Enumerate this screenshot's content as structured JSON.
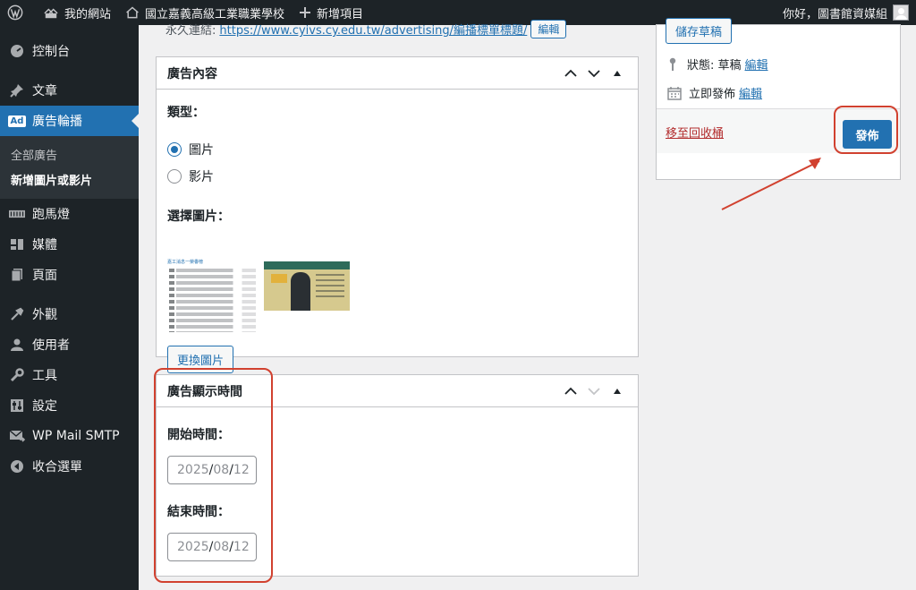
{
  "adminbar": {
    "site_name": "我的網站",
    "school_name": "國立嘉義高級工業職業學校",
    "new_item": "新增項目",
    "greeting": "你好，圖書館資媒組"
  },
  "sidebar": {
    "items": [
      {
        "label": "控制台",
        "icon": "dashboard-icon"
      },
      {
        "label": "文章",
        "icon": "pin-icon"
      },
      {
        "label": "廣告輪播",
        "icon": "ad-icon",
        "badge": "Ad"
      },
      {
        "label": "跑馬燈",
        "icon": "marquee-icon"
      },
      {
        "label": "媒體",
        "icon": "media-icon"
      },
      {
        "label": "頁面",
        "icon": "page-icon"
      },
      {
        "label": "外觀",
        "icon": "appearance-icon"
      },
      {
        "label": "使用者",
        "icon": "user-icon"
      },
      {
        "label": "工具",
        "icon": "wrench-icon"
      },
      {
        "label": "設定",
        "icon": "settings-icon"
      },
      {
        "label": "WP Mail SMTP",
        "icon": "mail-icon"
      },
      {
        "label": "收合選單",
        "icon": "collapse-icon"
      }
    ],
    "submenu": [
      "全部廣告",
      "新增圖片或影片"
    ]
  },
  "permalink": {
    "label": "永久連結:",
    "url": "https://www.cyivs.cy.edu.tw/advertising/編播標單標題/",
    "edit_button": "編輯"
  },
  "ad_content": {
    "title": "廣告內容",
    "type_label": "類型：",
    "options": [
      "圖片",
      "影片"
    ],
    "selected": "圖片",
    "choose_image_label": "選擇圖片：",
    "thumb_header": "嘉工消息一榮譽榜",
    "change_image_button": "更換圖片"
  },
  "ad_time": {
    "title": "廣告顯示時間",
    "start_label": "開始時間：",
    "end_label": "結束時間：",
    "start": {
      "year": "2025",
      "month": "08",
      "day": "12"
    },
    "end": {
      "year": "2025",
      "month": "08",
      "day": "12"
    }
  },
  "publish": {
    "save_draft": "儲存草稿",
    "status_label": "狀態: 草稿",
    "status_edit": "編輯",
    "publish_time": "立即發佈",
    "publish_time_edit": "編輯",
    "trash": "移至回收桶",
    "publish_button": "發佈"
  },
  "colors": {
    "accent": "#2271b1",
    "admin_dark": "#1d2327",
    "annotation_red": "#d1412f"
  }
}
